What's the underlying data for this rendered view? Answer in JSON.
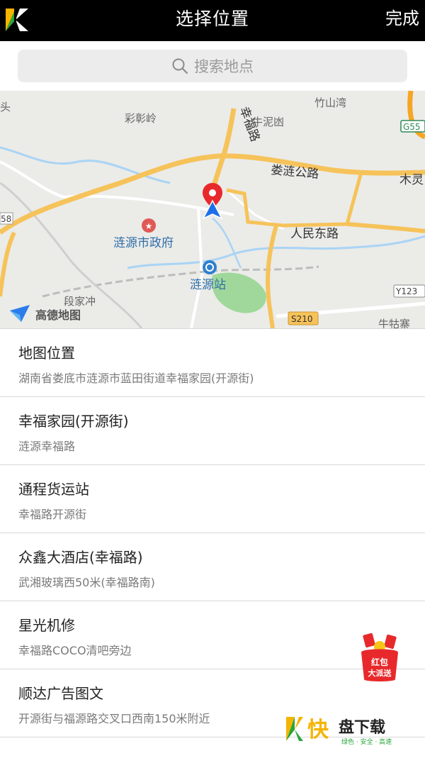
{
  "header": {
    "title": "选择位置",
    "done_label": "完成"
  },
  "search": {
    "placeholder": "搜索地点"
  },
  "map": {
    "labels": {
      "caizhangling": "彩彰岭",
      "zhushanwan": "竹山湾",
      "niunidang": "牛泥凼",
      "xingfulu": "幸福路",
      "loulian": "娄涟公路",
      "mulin": "木灵",
      "renmindong": "人民东路",
      "government": "涟源市政府",
      "station": "涟源站",
      "duanjiachong": "段家冲",
      "y123": "Y123",
      "s210": "S210",
      "g55": "G55",
      "num58": "58",
      "niuxian": "牛牯寨",
      "tou": "头"
    },
    "brand": "高德地图",
    "colors": {
      "road": "#f6c35a",
      "water": "#a9d4f5",
      "park": "#9fd89a",
      "pin": "#e8292b",
      "arrow": "#1c6fe8"
    }
  },
  "locations": [
    {
      "name": "地图位置",
      "address": "湖南省娄底市涟源市蓝田街道幸福家园(开源街)"
    },
    {
      "name": "幸福家园(开源街)",
      "address": "涟源幸福路"
    },
    {
      "name": "通程货运站",
      "address": "幸福路开源街"
    },
    {
      "name": "众鑫大酒店(幸福路)",
      "address": "武湘玻璃西50米(幸福路南)"
    },
    {
      "name": "星光机修",
      "address": "幸福路COCO清吧旁边"
    },
    {
      "name": "顺达广告图文",
      "address": "开源街与福源路交叉口西南150米附近"
    }
  ],
  "promo": {
    "line1": "红包",
    "line2": "大派送"
  },
  "watermark": {
    "brand": "快盘下载",
    "slogan": "绿色 · 安全 · 高速"
  },
  "icons": {
    "back": "back-logo-icon",
    "search": "search-icon",
    "pin": "location-pin-icon",
    "arrow": "navigation-arrow-icon"
  }
}
